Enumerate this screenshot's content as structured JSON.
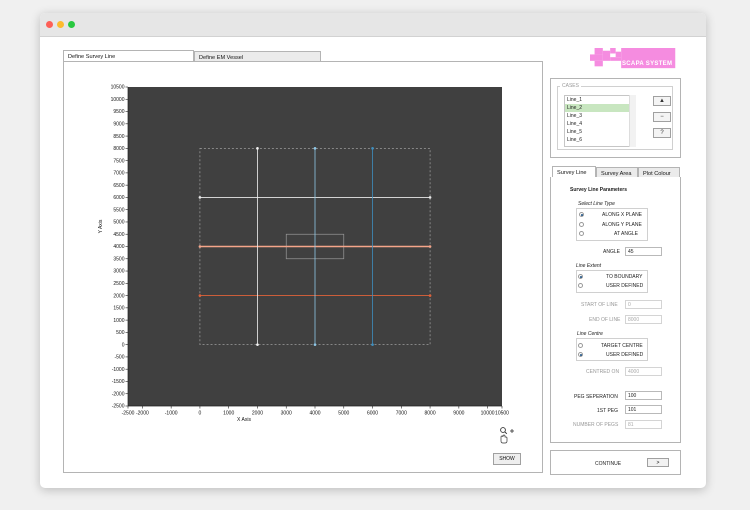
{
  "window": {
    "title": ""
  },
  "tabs": [
    {
      "label": "Define Survey Line",
      "active": true
    },
    {
      "label": "Define EM Vessel",
      "active": false
    }
  ],
  "logo": {
    "text": "SCAPA SYSTEM",
    "color": "#f58ce0"
  },
  "plot": {
    "background": "#404040",
    "show_label": "SHOW"
  },
  "chart_data": {
    "type": "line",
    "xlabel": "X Axis",
    "ylabel": "Y Axis",
    "xlim": [
      -2500,
      10500
    ],
    "ylim": [
      -2500,
      10500
    ],
    "x_ticks": [
      -2500,
      -2000,
      -1000,
      0,
      1000,
      2000,
      3000,
      4000,
      5000,
      6000,
      7000,
      8000,
      9000,
      10000,
      10500
    ],
    "y_ticks": [
      10500,
      10000,
      9500,
      9000,
      8500,
      8000,
      7500,
      7000,
      6500,
      6000,
      5500,
      5000,
      4500,
      4000,
      3500,
      3000,
      2500,
      2000,
      1500,
      1000,
      500,
      0,
      -500,
      -1000,
      -1500,
      -2000,
      -2500
    ],
    "boundary": {
      "x": [
        0,
        8000
      ],
      "y": [
        0,
        8000
      ],
      "color": "#b0b0b0"
    },
    "target": {
      "x": [
        3000,
        5000
      ],
      "y": [
        3500,
        4500
      ],
      "color": "#9a9a9a"
    },
    "series": [
      {
        "orientation": "horizontal",
        "y": 6000,
        "x": [
          0,
          8000
        ],
        "color": "#e8e8e8"
      },
      {
        "orientation": "horizontal",
        "y": 4000,
        "x": [
          0,
          8000
        ],
        "color": "#f5a58a"
      },
      {
        "orientation": "horizontal",
        "y": 2000,
        "x": [
          0,
          8000
        ],
        "color": "#e0623a"
      },
      {
        "orientation": "vertical",
        "x": 2000,
        "y": [
          0,
          8000
        ],
        "color": "#f2f2f2"
      },
      {
        "orientation": "vertical",
        "x": 4000,
        "y": [
          0,
          8000
        ],
        "color": "#8ec8e8"
      },
      {
        "orientation": "vertical",
        "x": 6000,
        "y": [
          0,
          8000
        ],
        "color": "#3f8fbf"
      }
    ]
  },
  "cases": {
    "legend": "CASES",
    "items": [
      "Line_1",
      "Line_2",
      "Line_3",
      "Line_4",
      "Line_5",
      "Line_6"
    ],
    "selected_index": 1,
    "buttons": {
      "up": "▲",
      "minus": "−",
      "question": "?"
    }
  },
  "settings_tabs": [
    {
      "label": "Survey Line",
      "active": true
    },
    {
      "label": "Survey Area",
      "active": false
    },
    {
      "label": "Plot Colour",
      "active": false
    }
  ],
  "survey": {
    "heading": "Survey Line Parameters",
    "line_type_label": "Select Line Type",
    "line_types": [
      "ALONG X PLANE",
      "ALONG Y PLANE",
      "AT ANGLE"
    ],
    "line_type_selected": 0,
    "angle_label": "ANGLE",
    "angle_value": "45",
    "extent_label": "Line Extent",
    "extents": [
      "TO BOUNDARY",
      "USER DEFINED"
    ],
    "extent_selected": 0,
    "start_label": "START OF LINE",
    "start_value": "0",
    "end_label": "END OF LINE",
    "end_value": "8000",
    "centre_label": "Line Centre",
    "centres": [
      "TARGET CENTRE",
      "USER DEFINED"
    ],
    "centre_selected": 1,
    "centred_on_label": "CENTRED ON",
    "centred_on_value": "4000",
    "peg_sep_label": "PEG SEPERATION",
    "peg_sep_value": "100",
    "first_peg_label": "1ST PEG",
    "first_peg_value": "101",
    "num_pegs_label": "NUMBER OF PEGS",
    "num_pegs_value": "81"
  },
  "footer": {
    "continue_label": "CONTINUE",
    "continue_button": ">"
  }
}
